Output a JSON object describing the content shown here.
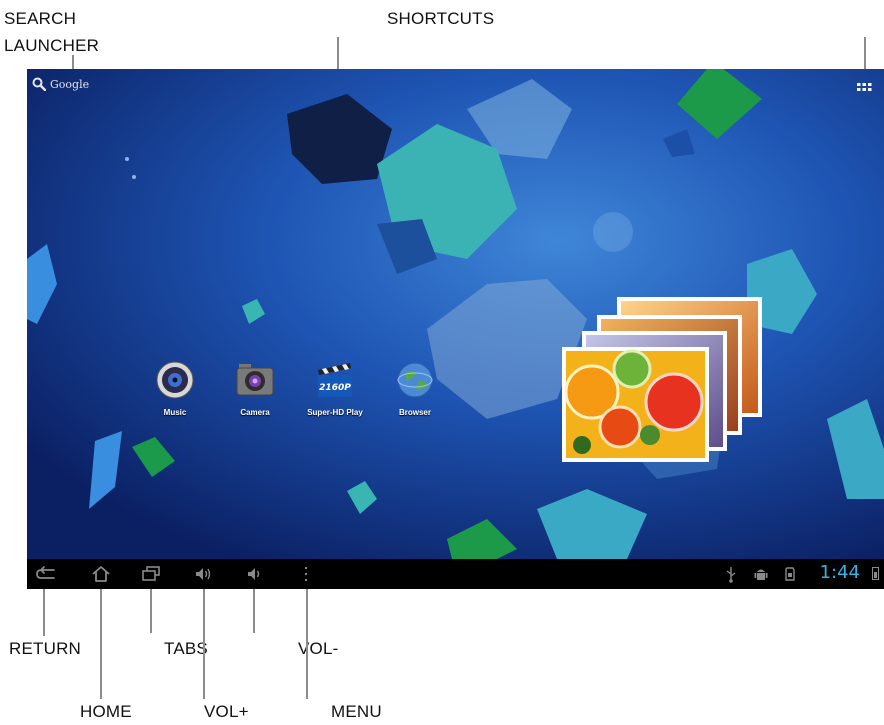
{
  "callouts": {
    "search": "SEARCH",
    "launcher": "LAUNCHER",
    "shortcuts": "SHORTCUTS",
    "return": "RETURN",
    "tabs": "TABS",
    "vol_minus": "VOL-",
    "home": "HOME",
    "vol_plus": "VOL+",
    "menu": "MENU"
  },
  "screen": {
    "search": {
      "label": "Google",
      "icon": "search-icon"
    },
    "apps_button_icon": "apps-grid-icon",
    "apps": [
      {
        "label": "Music",
        "icon": "music-icon"
      },
      {
        "label": "Camera",
        "icon": "camera-icon"
      },
      {
        "label": "Super-HD Play",
        "icon": "video-player-icon",
        "badge": "2160P"
      },
      {
        "label": "Browser",
        "icon": "globe-icon"
      }
    ],
    "widget": {
      "type": "photo-gallery",
      "icon": "photo-stack-icon"
    },
    "navbar": {
      "buttons": [
        {
          "name": "return",
          "icon": "back-icon"
        },
        {
          "name": "home",
          "icon": "home-icon"
        },
        {
          "name": "tabs",
          "icon": "recent-apps-icon"
        },
        {
          "name": "vol+",
          "icon": "volume-up-icon"
        },
        {
          "name": "vol-",
          "icon": "volume-down-icon"
        },
        {
          "name": "menu",
          "icon": "menu-icon"
        }
      ],
      "status_icons": [
        "usb-icon",
        "android-debug-icon",
        "sd-card-icon"
      ],
      "clock": "1:44",
      "battery_icon": "battery-icon"
    }
  },
  "colors": {
    "wallpaper": "#102c7a",
    "navbar": "#000000",
    "clock": "#33b5e5",
    "callout_line": "#8c8c8c"
  }
}
